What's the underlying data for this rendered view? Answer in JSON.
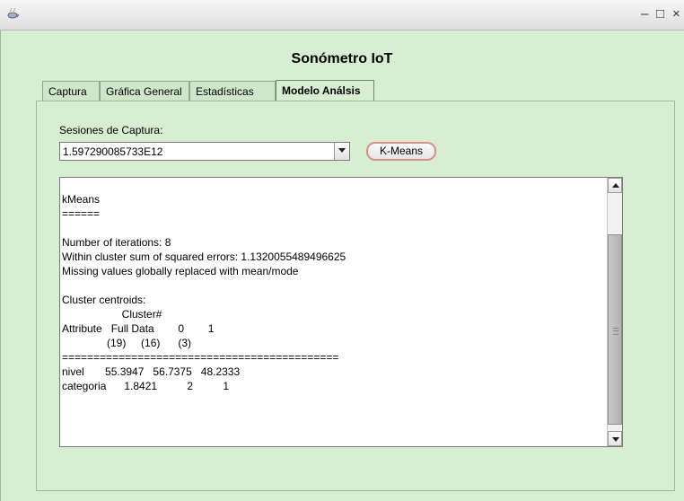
{
  "window": {
    "icon": "java-cup-icon",
    "controls": {
      "minimize": "–",
      "maximize": "□",
      "close": "×"
    }
  },
  "app": {
    "title": "Sonómetro IoT"
  },
  "tabs": [
    {
      "label": "Captura",
      "active": false
    },
    {
      "label": "Gráfica General",
      "active": false
    },
    {
      "label": "Estadísticas",
      "active": false
    },
    {
      "label": "Modelo Análsis",
      "active": true
    }
  ],
  "sessions": {
    "label": "Sesiones de Captura:",
    "selected": "1.597290085733E12"
  },
  "kmeans_button": {
    "label": "K-Means"
  },
  "result": {
    "text": "kMeans\n======\n\nNumber of iterations: 8\nWithin cluster sum of squared errors: 1.1320055489496625\nMissing values globally replaced with mean/mode\n\nCluster centroids:\n                    Cluster#\nAttribute   Full Data        0        1\n               (19)     (16)      (3)\n============================================\nnivel       55.3947   56.7375   48.2333\ncategoria      1.8421          2          1"
  },
  "colors": {
    "background": "#d7eed3",
    "button_border": "#d98e8e"
  }
}
